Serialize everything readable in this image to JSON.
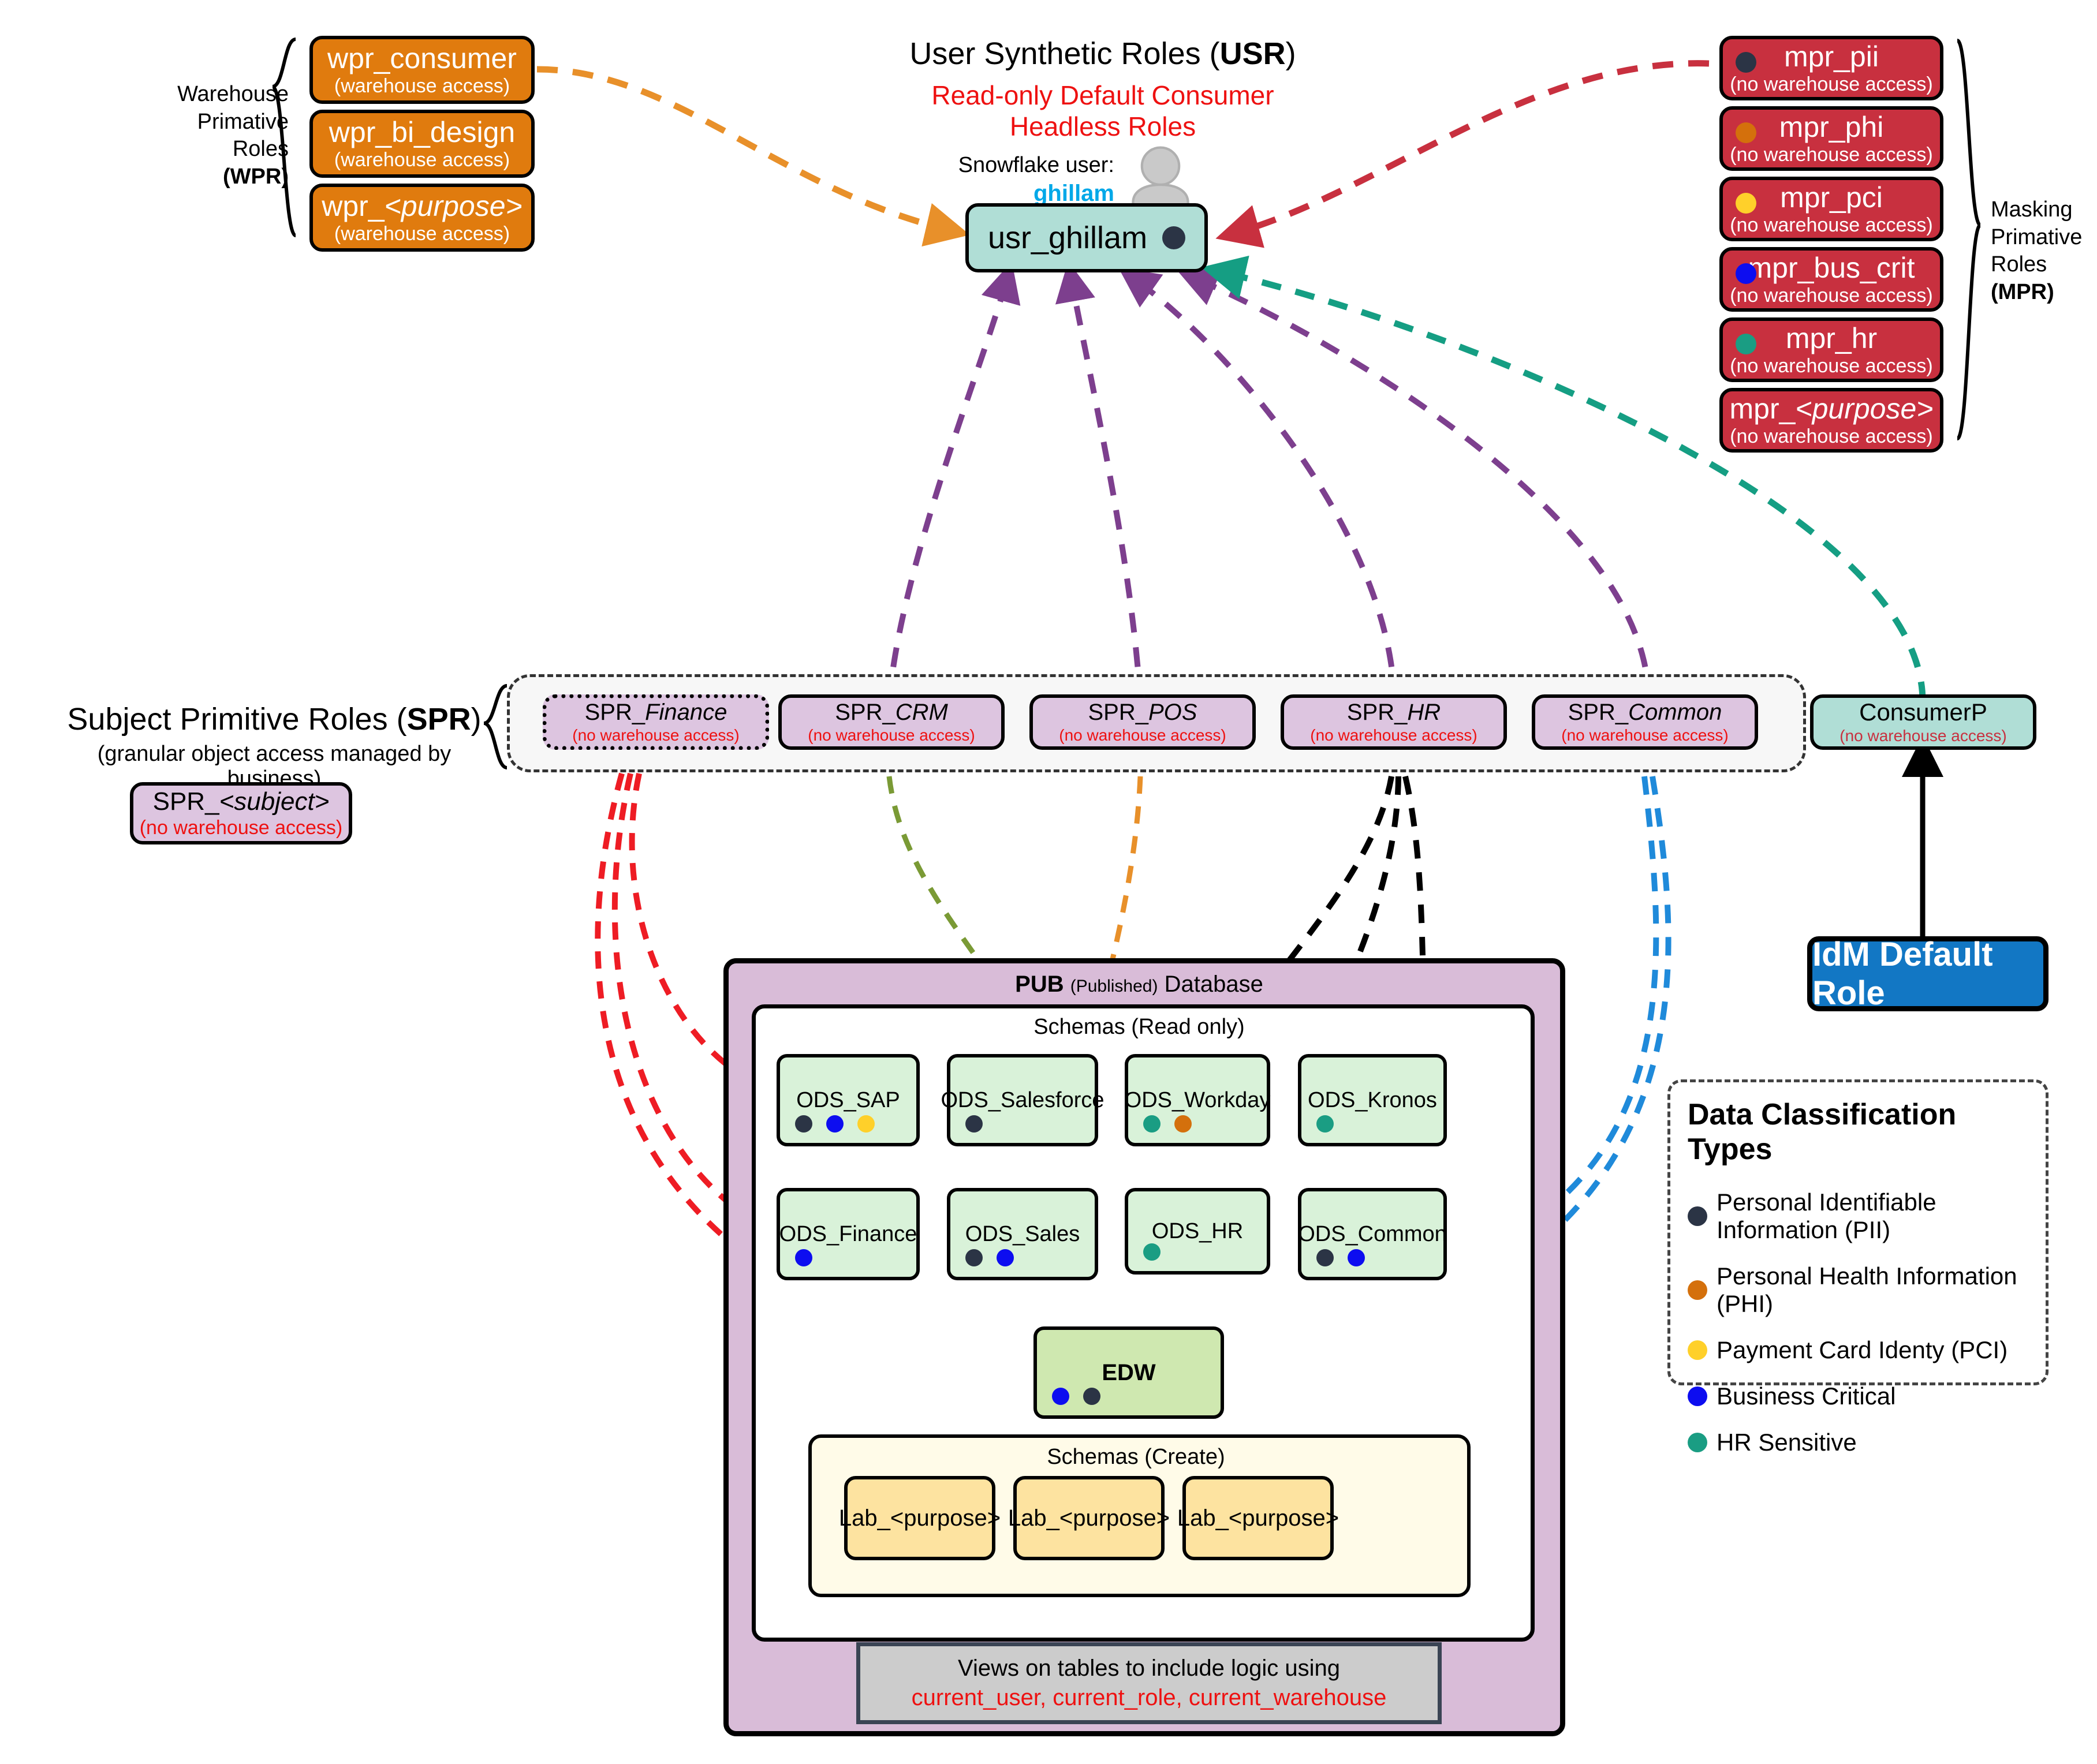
{
  "title_block": {
    "usr_title_plain": "User Synthetic Roles (",
    "usr_title_bold": "USR",
    "usr_title_close": ")",
    "sub1": "Read-only Default Consumer",
    "sub2": "Headless Roles",
    "snowflake_user_label": "Snowflake user:",
    "snowflake_user_name": "ghillam"
  },
  "user_role": {
    "label": "usr_ghillam",
    "tags": [
      "pii"
    ]
  },
  "wpr": {
    "group_label_lines": [
      "Warehouse",
      "Primative",
      "Roles"
    ],
    "group_abbrev": "(WPR)",
    "items": [
      {
        "name": "wpr_consumer",
        "sub": "(warehouse access)",
        "italic": false
      },
      {
        "name": "wpr_bi_design",
        "sub": "(warehouse access)",
        "italic": false
      },
      {
        "name": "wpr_<purpose>",
        "prefix": "wpr_",
        "italic_part": "<purpose>",
        "sub": "(warehouse access)",
        "italic": true
      }
    ]
  },
  "mpr": {
    "group_label_lines": [
      "Masking",
      "Primative",
      "Roles"
    ],
    "group_abbrev": "(MPR)",
    "items": [
      {
        "name": "mpr_pii",
        "sub": "(no warehouse access)",
        "dot": "pii"
      },
      {
        "name": "mpr_phi",
        "sub": "(no warehouse access)",
        "dot": "phi"
      },
      {
        "name": "mpr_pci",
        "sub": "(no warehouse access)",
        "dot": "pci"
      },
      {
        "name": "mpr_bus_crit",
        "sub": "(no warehouse access)",
        "dot": "bus"
      },
      {
        "name": "mpr_hr",
        "sub": "(no warehouse access)",
        "dot": "hr"
      },
      {
        "name": "mpr_<purpose>",
        "prefix": "mpr_",
        "italic_part": "<purpose>",
        "sub": "(no warehouse access)",
        "dot": null,
        "italic": true
      }
    ]
  },
  "spr": {
    "title_plain": "Subject Primitive Roles (",
    "title_bold": "SPR",
    "title_close": ")",
    "subtitle": "(granular object access managed by business)",
    "template": {
      "prefix": "SPR_",
      "italic_part": "<subject>",
      "sub": "(no warehouse access)"
    },
    "items": [
      {
        "prefix": "SPR_",
        "italic_part": "Finance",
        "sub": "(no warehouse access)",
        "dashed": true
      },
      {
        "prefix": "SPR_",
        "italic_part": "CRM",
        "sub": "(no warehouse access)",
        "dashed": false
      },
      {
        "prefix": "SPR_",
        "italic_part": "POS",
        "sub": "(no warehouse access)",
        "dashed": false
      },
      {
        "prefix": "SPR_",
        "italic_part": "HR",
        "sub": "(no warehouse access)",
        "dashed": false
      },
      {
        "prefix": "SPR_",
        "italic_part": "Common",
        "sub": "(no warehouse access)",
        "dashed": false
      }
    ]
  },
  "consumer_role": {
    "name": "ConsumerP",
    "sub": "(no warehouse access)"
  },
  "idm": {
    "label": "IdM Default Role"
  },
  "pub": {
    "title_bold": "PUB",
    "title_small": "(Published)",
    "title_rest": "Database",
    "schemas_read_label": "Schemas (Read only)",
    "schemas_create_label": "Schemas (Create)",
    "row1": [
      {
        "name": "ODS_SAP",
        "tags": [
          "pii",
          "bus",
          "pci"
        ]
      },
      {
        "name": "ODS_Salesforce",
        "tags": [
          "pii"
        ]
      },
      {
        "name": "ODS_Workday",
        "tags": [
          "hr",
          "phi"
        ]
      },
      {
        "name": "ODS_Kronos",
        "tags": [
          "hr"
        ]
      }
    ],
    "row2": [
      {
        "name": "ODS_Finance",
        "tags": [
          "bus"
        ]
      },
      {
        "name": "ODS_Sales",
        "tags": [
          "pii",
          "bus"
        ]
      },
      {
        "name": "ODS_HR",
        "tags": [
          "hr"
        ]
      },
      {
        "name": "ODS_Common",
        "tags": [
          "pii",
          "bus"
        ]
      }
    ],
    "edw": {
      "name": "EDW",
      "tags": [
        "bus",
        "pii"
      ]
    },
    "labs": [
      {
        "name": "Lab_<purpose>"
      },
      {
        "name": "Lab_<purpose>"
      },
      {
        "name": "Lab_<purpose>"
      }
    ],
    "views_line1": "Views on tables to include logic using",
    "views_line2_parts": [
      "current_user",
      "current_role",
      "current_warehouse"
    ],
    "views_line2": "current_user, current_role, current_warehouse"
  },
  "legend": {
    "title": "Data Classification Types",
    "items": [
      {
        "key": "pii",
        "label": "Personal Identifiable Information (PII)",
        "color": "#2b3445"
      },
      {
        "key": "phi",
        "label": "Personal Health Information (PHI)",
        "color": "#d4700c"
      },
      {
        "key": "pci",
        "label": "Payment Card Identy (PCI)",
        "color": "#ffd02a"
      },
      {
        "key": "bus",
        "label": "Business Critical",
        "color": "#0d0df0"
      },
      {
        "key": "hr",
        "label": "HR Sensitive",
        "color": "#1a9d83"
      }
    ]
  },
  "colors": {
    "pii": "#2b3445",
    "phi": "#d4700c",
    "pci": "#ffd02a",
    "bus": "#0d0df0",
    "hr": "#1a9d83",
    "wpr_fill": "#e07b0e",
    "mpr_fill": "#c8303f",
    "spr_fill": "#ddc5e0",
    "teal_fill": "#b0ded6",
    "pub_fill": "#d9bcd8",
    "ods_fill": "#d9f2d9",
    "edw_fill": "#cfe8b0",
    "lab_fill": "#fde3a0",
    "idm_fill": "#1277c4",
    "arrow_orange": "#e8902a",
    "arrow_crimson": "#c8303f",
    "arrow_purple": "#7d3f8e",
    "arrow_teal": "#159e83",
    "arrow_red": "#ee1c24",
    "arrow_olive": "#7a9a35",
    "arrow_black": "#000000",
    "arrow_blue": "#1f8ada"
  }
}
